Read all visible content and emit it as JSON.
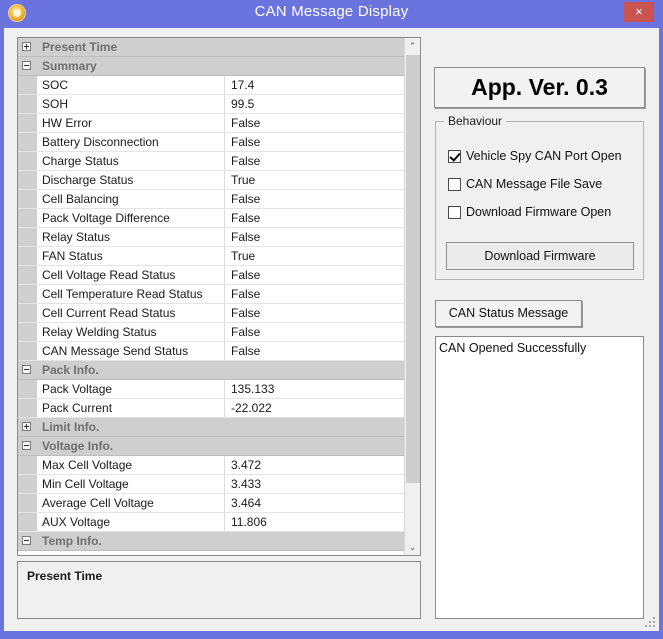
{
  "window": {
    "title": "CAN Message Display",
    "app_icon": "sun-app-icon",
    "close_label": "×",
    "titlebar_color": "#6b74de",
    "close_button_color": "#c9544f"
  },
  "property_grid": {
    "rows": [
      {
        "kind": "category",
        "expander": "plus",
        "label": "Present Time"
      },
      {
        "kind": "category",
        "expander": "minus",
        "label": "Summary"
      },
      {
        "kind": "property",
        "name": "SOC",
        "value": "17.4"
      },
      {
        "kind": "property",
        "name": "SOH",
        "value": "99.5"
      },
      {
        "kind": "property",
        "name": "HW Error",
        "value": "False"
      },
      {
        "kind": "property",
        "name": "Battery Disconnection",
        "value": "False"
      },
      {
        "kind": "property",
        "name": "Charge Status",
        "value": "False"
      },
      {
        "kind": "property",
        "name": "Discharge Status",
        "value": "True"
      },
      {
        "kind": "property",
        "name": "Cell Balancing",
        "value": "False"
      },
      {
        "kind": "property",
        "name": "Pack Voltage Difference",
        "value": "False"
      },
      {
        "kind": "property",
        "name": "Relay Status",
        "value": "False"
      },
      {
        "kind": "property",
        "name": "FAN Status",
        "value": "True"
      },
      {
        "kind": "property",
        "name": "Cell Voltage Read Status",
        "value": "False"
      },
      {
        "kind": "property",
        "name": "Cell Temperature Read Status",
        "value": "False"
      },
      {
        "kind": "property",
        "name": "Cell Current Read Status",
        "value": "False"
      },
      {
        "kind": "property",
        "name": "Relay Welding Status",
        "value": "False"
      },
      {
        "kind": "property",
        "name": "CAN Message Send Status",
        "value": "False"
      },
      {
        "kind": "category",
        "expander": "minus",
        "label": "Pack Info."
      },
      {
        "kind": "property",
        "name": "Pack Voltage",
        "value": "135.133"
      },
      {
        "kind": "property",
        "name": "Pack Current",
        "value": "-22.022"
      },
      {
        "kind": "category",
        "expander": "plus",
        "label": "Limit Info."
      },
      {
        "kind": "category",
        "expander": "minus",
        "label": "Voltage Info."
      },
      {
        "kind": "property",
        "name": "Max Cell Voltage",
        "value": "3.472"
      },
      {
        "kind": "property",
        "name": "Min Cell Voltage",
        "value": "3.433"
      },
      {
        "kind": "property",
        "name": "Average Cell Voltage",
        "value": "3.464"
      },
      {
        "kind": "property",
        "name": "AUX Voltage",
        "value": "11.806"
      },
      {
        "kind": "category",
        "expander": "minus",
        "label": "Temp Info."
      }
    ],
    "scrollbar": {
      "up_arrow": "⌃",
      "down_arrow": "⌄"
    }
  },
  "description_pane": {
    "title": "Present Time"
  },
  "right_panel": {
    "app_version_label": "App. Ver. 0.3",
    "behaviour": {
      "legend": "Behaviour",
      "checkboxes": [
        {
          "label": "Vehicle Spy CAN Port Open",
          "checked": true
        },
        {
          "label": "CAN Message File Save",
          "checked": false
        },
        {
          "label": "Download Firmware Open",
          "checked": false
        }
      ],
      "download_firmware_label": "Download Firmware"
    },
    "can_status_button_label": "CAN Status Message",
    "can_messages": [
      "CAN Opened Successfully"
    ]
  }
}
